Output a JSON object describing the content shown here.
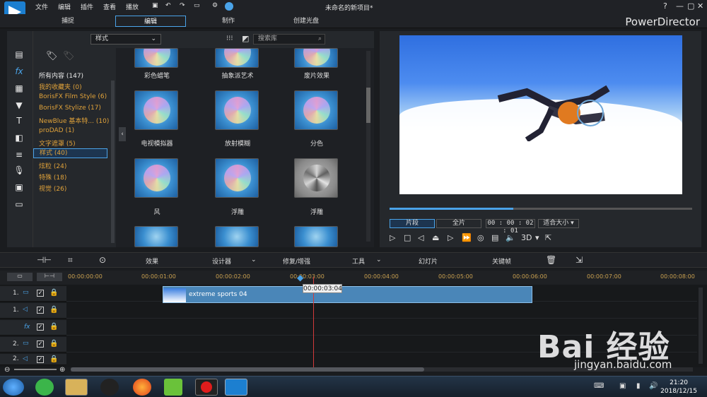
{
  "menu": {
    "items": [
      "文件",
      "编辑",
      "插件",
      "查看",
      "播放"
    ],
    "title": "未命名的新项目*",
    "help": "?",
    "minimize": "—",
    "maximize": "▢",
    "close": "✕"
  },
  "modes": {
    "tabs": [
      "捕捉",
      "编辑",
      "制作",
      "创建光盘"
    ],
    "brand": "PowerDirector"
  },
  "categories": [
    "所有内容 (147)",
    "我的收藏夹 (0)",
    "BorisFX Film Style  (6)",
    "BorisFX Stylize  (17)",
    "NewBlue 基本特...  (10)",
    "proDAD  (1)",
    "文字遮罩  (5)",
    "样式  (40)",
    "炫粒  (24)",
    "特殊  (18)",
    "视觉  (26)"
  ],
  "library": {
    "filter": "样式",
    "search_placeholder": "搜索库",
    "thumbs": [
      "彩色蜡笔",
      "抽象派艺术",
      "废片效果",
      "电视模拟器",
      "放射模糊",
      "分色",
      "风",
      "浮雕",
      "浮雕"
    ]
  },
  "preview": {
    "clip_btn": "片段",
    "movie_btn": "全片",
    "timecode": "00 : 00 : 02 : 01",
    "fit": "适合大小",
    "mode3d": "3D"
  },
  "toolbar": {
    "effects": "效果",
    "designer": "设计器",
    "fix": "修复/增强",
    "tools": "工具",
    "slideshow": "幻灯片",
    "keyframe": "关键帧"
  },
  "timeline": {
    "ticks": [
      "00:00:00:00",
      "00:00:01:00",
      "00:00:02:00",
      "00:00:03:00",
      "00:00:04:00",
      "00:00:05:00",
      "00:00:06:00",
      "00:00:07:00",
      "00:00:08:00"
    ],
    "tracks": [
      "1.",
      "1.",
      "fx",
      "2.",
      "2."
    ],
    "clip_name": "extreme sports 04",
    "playhead_time": "00:00:03:04"
  },
  "taskbar": {
    "time": "21:20",
    "date": "2018/12/15"
  },
  "watermark": {
    "brand": "Bai 经验",
    "url": "jingyan.baidu.com"
  },
  "colors": {
    "accent": "#4aa3e8",
    "category": "#e0a23a",
    "playhead": "#d23a3a"
  }
}
